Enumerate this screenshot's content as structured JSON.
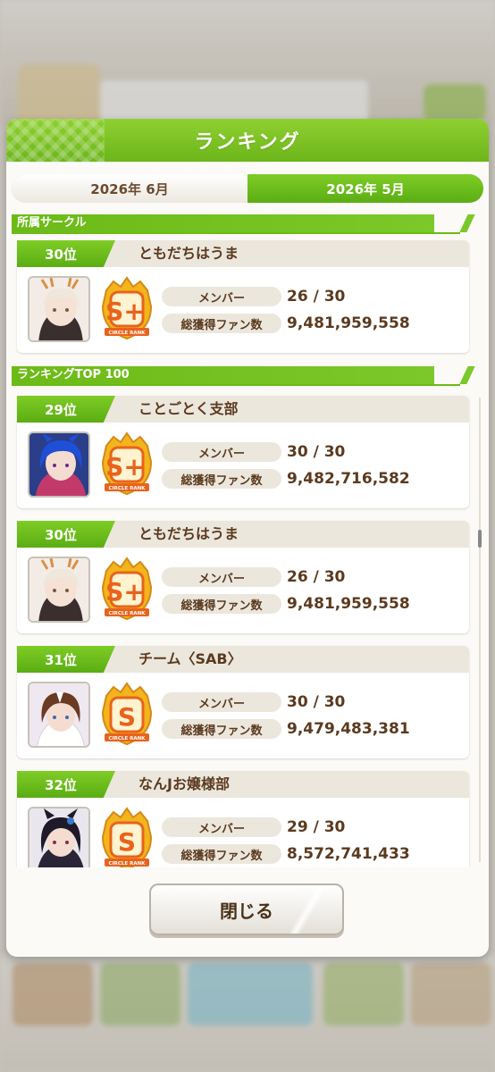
{
  "dialog": {
    "title": "ランキング"
  },
  "tabs": [
    {
      "label": "2026年 6月",
      "active": false
    },
    {
      "label": "2026年 5月",
      "active": true
    }
  ],
  "my_circle": {
    "section_label": "所属サークル",
    "rank": "30位",
    "name": "ともだちはうま",
    "member_label": "メンバー",
    "members": "26 / 30",
    "fans_label": "総獲得ファン数",
    "fans": "9,481,959,558",
    "badge": "S+"
  },
  "ranking": {
    "section_label": "ランキングTOP 100",
    "rows": [
      {
        "rank": "29位",
        "name": "ことごとく支部",
        "member_label": "メンバー",
        "members": "30 / 30",
        "fans_label": "総獲得ファン数",
        "fans": "9,482,716,582",
        "badge": "S+"
      },
      {
        "rank": "30位",
        "name": "ともだちはうま",
        "member_label": "メンバー",
        "members": "26 / 30",
        "fans_label": "総獲得ファン数",
        "fans": "9,481,959,558",
        "badge": "S+"
      },
      {
        "rank": "31位",
        "name": "チーム〈SAB〉",
        "member_label": "メンバー",
        "members": "30 / 30",
        "fans_label": "総獲得ファン数",
        "fans": "9,479,483,381",
        "badge": "S"
      },
      {
        "rank": "32位",
        "name": "なんJお嬢様部",
        "member_label": "メンバー",
        "members": "29 / 30",
        "fans_label": "総獲得ファン数",
        "fans": "8,572,741,433",
        "badge": "S"
      }
    ]
  },
  "badge_caption": "CIRCLE RANK",
  "close_button": "閉じる",
  "colors": {
    "accent_green": "#6cb51a",
    "text_brown": "#5b3a1f",
    "badge_gold": "#f2b51c",
    "badge_orange": "#e8631c"
  }
}
